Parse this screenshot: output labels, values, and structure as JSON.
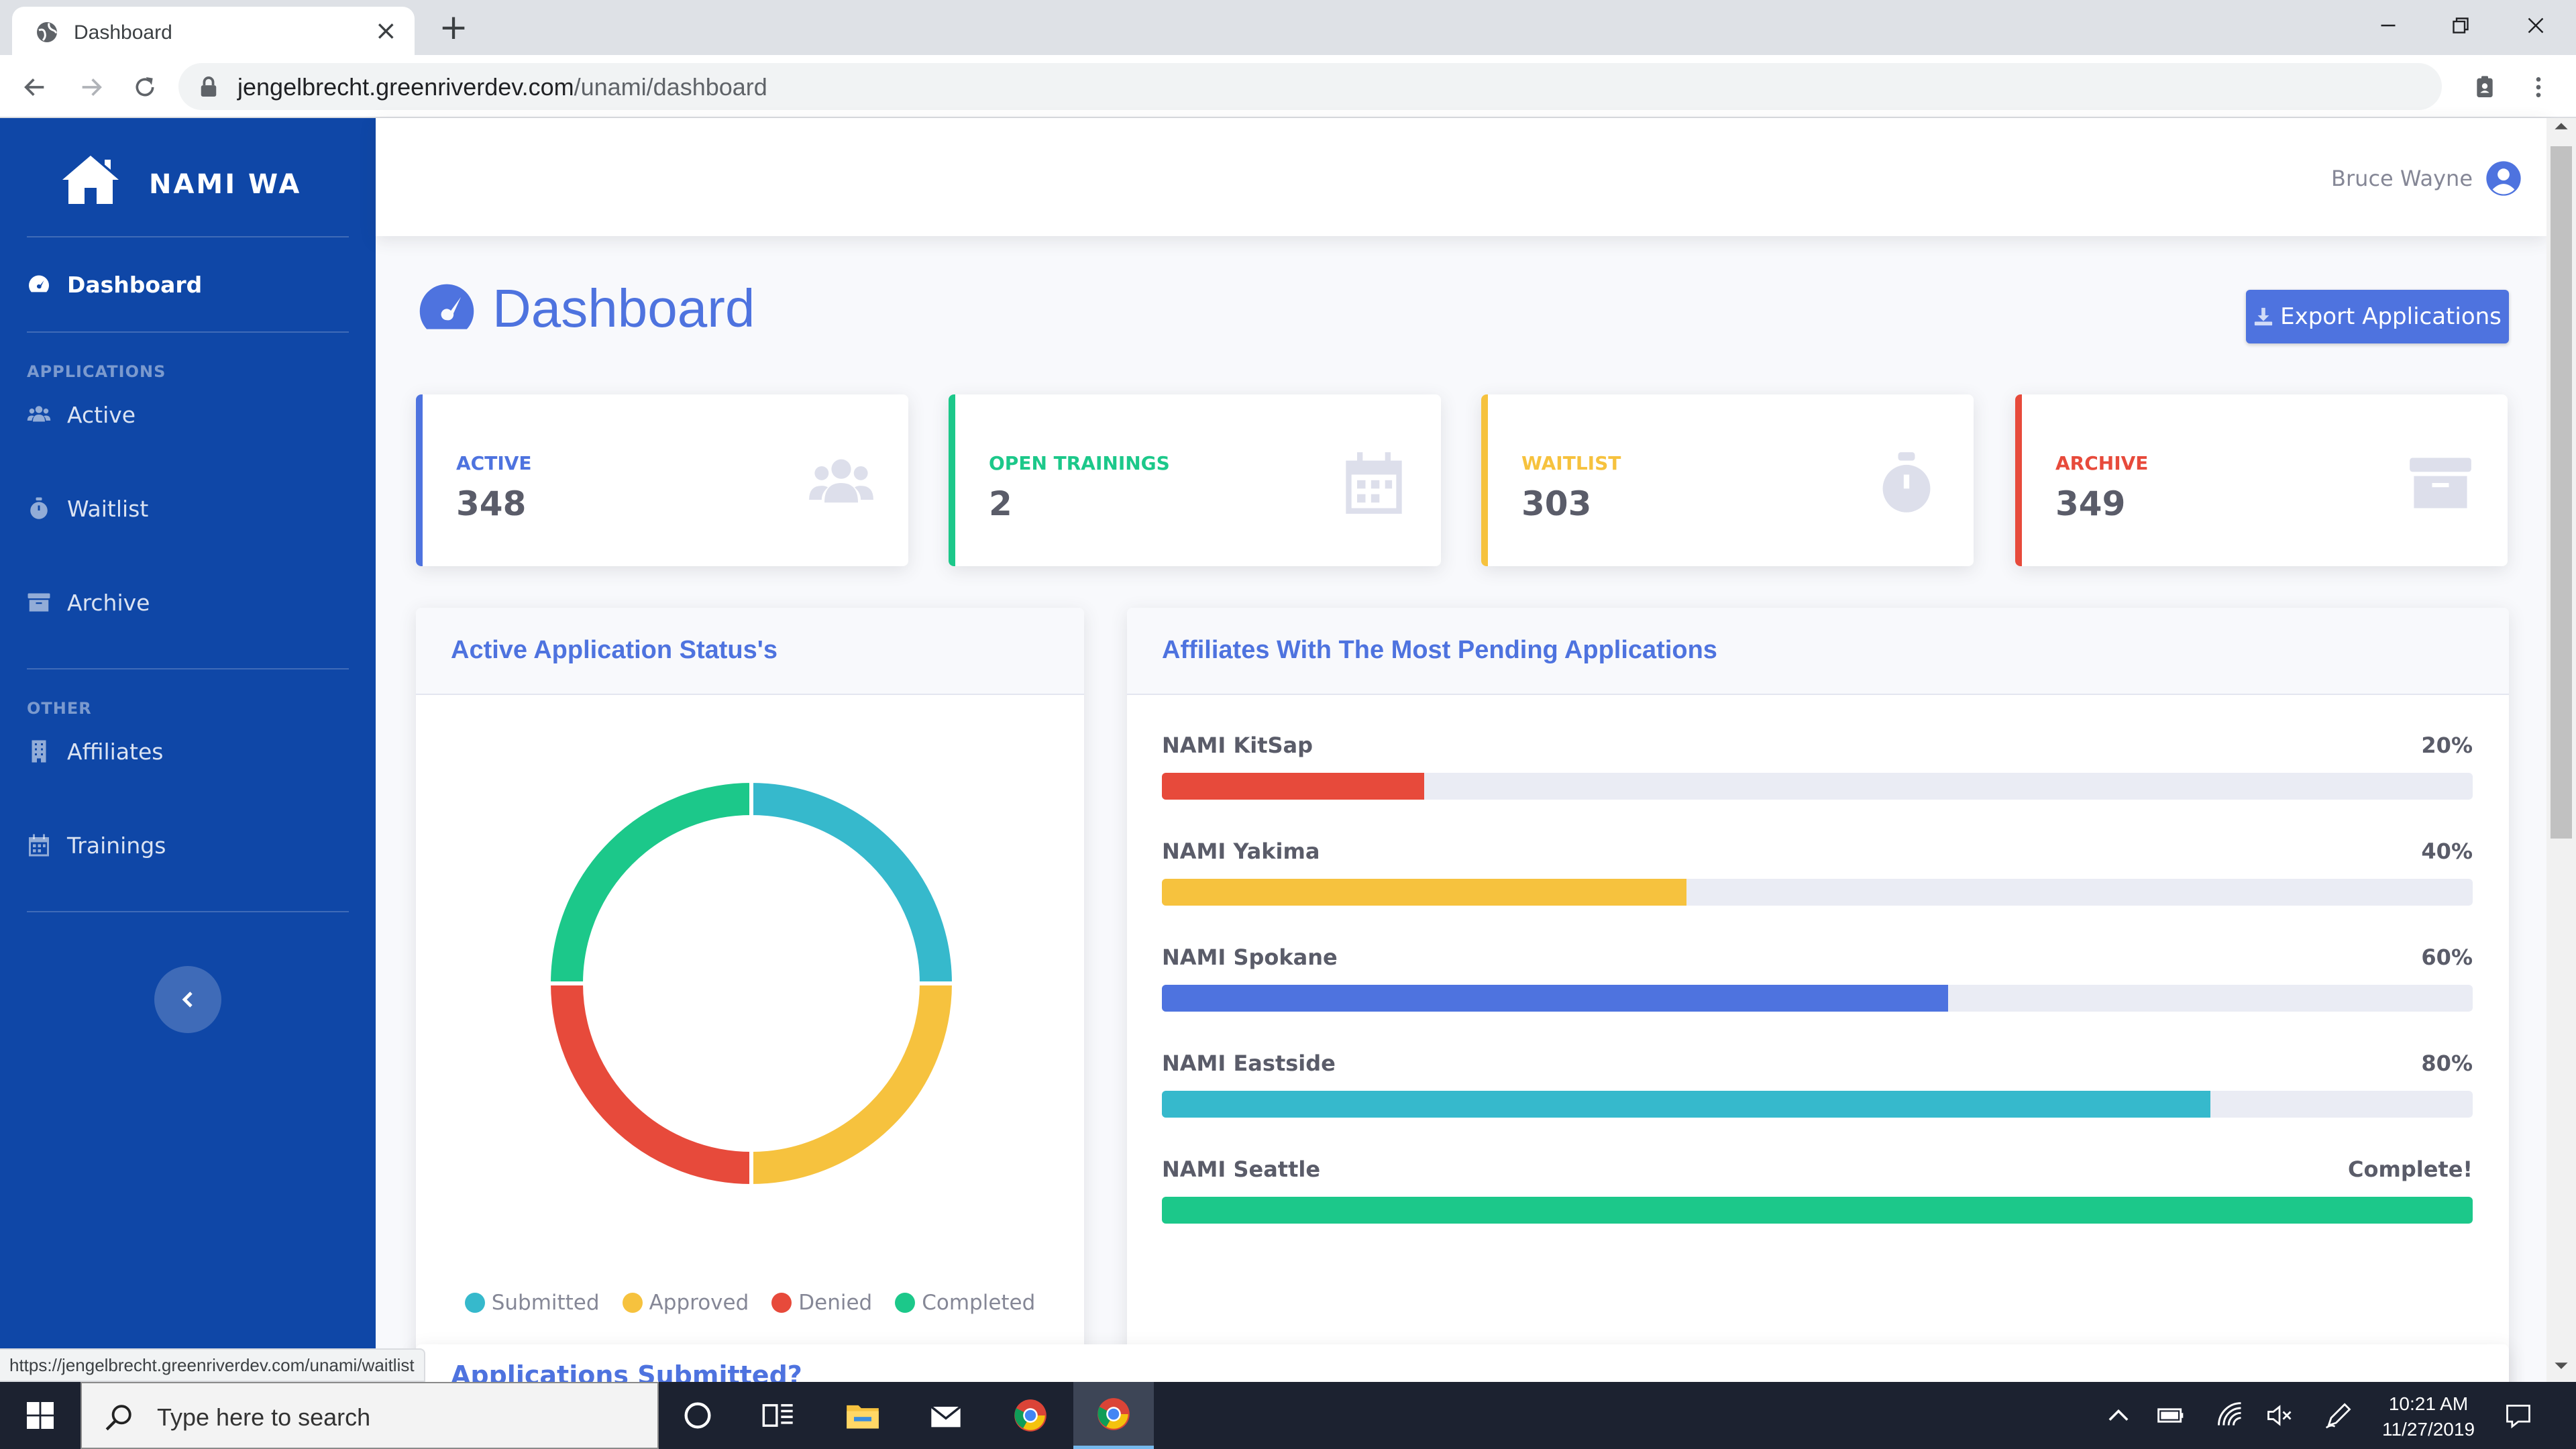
{
  "browser": {
    "tab_title": "Dashboard",
    "url_host": "jengelbrecht.greenriverdev.com",
    "url_path": "/unami/dashboard",
    "status_url": "https://jengelbrecht.greenriverdev.com/unami/waitlist"
  },
  "sidebar": {
    "brand": "NAMI WA",
    "dashboard_label": "Dashboard",
    "section_applications": "APPLICATIONS",
    "section_other": "OTHER",
    "items": [
      {
        "label": "Active",
        "icon": "users-icon"
      },
      {
        "label": "Waitlist",
        "icon": "stopwatch-icon"
      },
      {
        "label": "Archive",
        "icon": "archive-icon"
      },
      {
        "label": "Affiliates",
        "icon": "building-icon"
      },
      {
        "label": "Trainings",
        "icon": "calendar-icon"
      }
    ]
  },
  "topbar": {
    "user_name": "Bruce Wayne"
  },
  "header": {
    "title": "Dashboard",
    "export_label": "Export Applications"
  },
  "stats": [
    {
      "label": "ACTIVE",
      "value": "348",
      "color": "#4e73df",
      "icon": "users-icon"
    },
    {
      "label": "OPEN TRAININGS",
      "value": "2",
      "color": "#1cc88a",
      "icon": "calendar-icon"
    },
    {
      "label": "WAITLIST",
      "value": "303",
      "color": "#f6c23e",
      "icon": "stopwatch-icon"
    },
    {
      "label": "ARCHIVE",
      "value": "349",
      "color": "#e74a3b",
      "icon": "archive-icon"
    }
  ],
  "status_chart": {
    "title": "Active Application Status's",
    "legend": [
      {
        "label": "Submitted",
        "color": "#36b9cc",
        "value": 25
      },
      {
        "label": "Approved",
        "color": "#f6c23e",
        "value": 25
      },
      {
        "label": "Denied",
        "color": "#e74a3b",
        "value": 25
      },
      {
        "label": "Completed",
        "color": "#1cc88a",
        "value": 25
      }
    ]
  },
  "affiliates": {
    "title": "Affiliates With The Most Pending Applications",
    "items": [
      {
        "name": "NAMI KitSap",
        "percent_label": "20%",
        "percent": 20,
        "color": "#e74a3b"
      },
      {
        "name": "NAMI Yakima",
        "percent_label": "40%",
        "percent": 40,
        "color": "#f6c23e"
      },
      {
        "name": "NAMI Spokane",
        "percent_label": "60%",
        "percent": 60,
        "color": "#4e73df"
      },
      {
        "name": "NAMI Eastside",
        "percent_label": "80%",
        "percent": 80,
        "color": "#36b9cc"
      },
      {
        "name": "NAMI Seattle",
        "percent_label": "Complete!",
        "percent": 100,
        "color": "#1cc88a"
      }
    ]
  },
  "partial_card_title": "Applications Submitted?",
  "taskbar": {
    "search_placeholder": "Type here to search",
    "time": "10:21 AM",
    "date": "11/27/2019"
  }
}
